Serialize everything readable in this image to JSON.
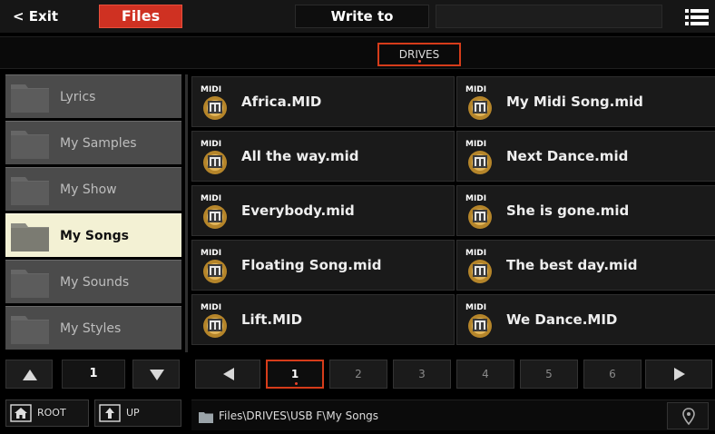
{
  "topbar": {
    "exit_label": "< Exit",
    "files_tab_label": "Files",
    "write_to_label": "Write to",
    "write_to_value": "",
    "menu_icon": "list-menu-icon"
  },
  "drives": {
    "tab_label": "DRIVES"
  },
  "folders": [
    {
      "label": "Lyrics",
      "selected": false
    },
    {
      "label": "My Samples",
      "selected": false
    },
    {
      "label": "My Show",
      "selected": false
    },
    {
      "label": "My Songs",
      "selected": true
    },
    {
      "label": "My Sounds",
      "selected": false
    },
    {
      "label": "My Styles",
      "selected": false
    }
  ],
  "folder_pager": {
    "page": "1"
  },
  "nav_buttons": {
    "root_label": "ROOT",
    "up_label": "UP"
  },
  "files": [
    {
      "icon_tag": "MIDI",
      "name": "Africa.MID"
    },
    {
      "icon_tag": "MIDI",
      "name": "My Midi Song.mid"
    },
    {
      "icon_tag": "MIDI",
      "name": "All the way.mid"
    },
    {
      "icon_tag": "MIDI",
      "name": "Next Dance.mid"
    },
    {
      "icon_tag": "MIDI",
      "name": "Everybody.mid"
    },
    {
      "icon_tag": "MIDI",
      "name": "She is gone.mid"
    },
    {
      "icon_tag": "MIDI",
      "name": "Floating Song.mid"
    },
    {
      "icon_tag": "MIDI",
      "name": "The best day.mid"
    },
    {
      "icon_tag": "MIDI",
      "name": "Lift.MID"
    },
    {
      "icon_tag": "MIDI",
      "name": "We Dance.MID"
    }
  ],
  "file_pager": {
    "pages": [
      "1",
      "2",
      "3",
      "4",
      "5",
      "6"
    ],
    "current": "1"
  },
  "path": {
    "text": "Files\\DRIVES\\USB F\\My Songs"
  },
  "colors": {
    "accent": "#cf3122",
    "selected_folder": "#f3f1d4"
  }
}
